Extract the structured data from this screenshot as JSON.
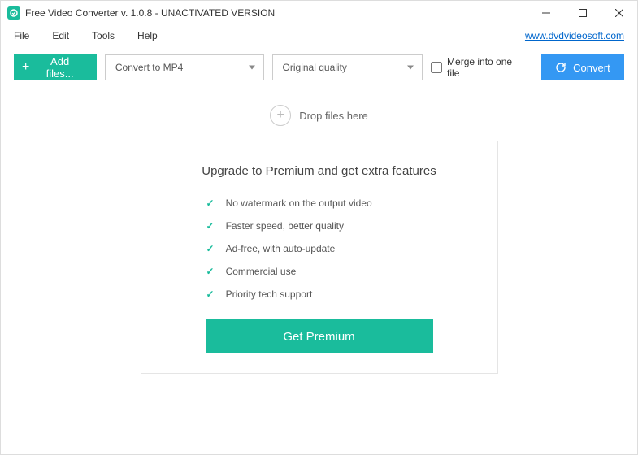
{
  "titlebar": {
    "title": "Free Video Converter v. 1.0.8 - UNACTIVATED VERSION"
  },
  "menubar": {
    "items": [
      "File",
      "Edit",
      "Tools",
      "Help"
    ],
    "link": "www.dvdvideosoft.com"
  },
  "toolbar": {
    "add_label": "Add files...",
    "format_selected": "Convert to MP4",
    "quality_selected": "Original quality",
    "merge_label": "Merge into one file",
    "convert_label": "Convert"
  },
  "dropzone": {
    "text": "Drop files here"
  },
  "premium": {
    "title": "Upgrade to Premium and get extra features",
    "features": [
      "No watermark on the output video",
      "Faster speed, better quality",
      "Ad-free, with auto-update",
      "Commercial use",
      "Priority tech support"
    ],
    "button": "Get Premium"
  }
}
